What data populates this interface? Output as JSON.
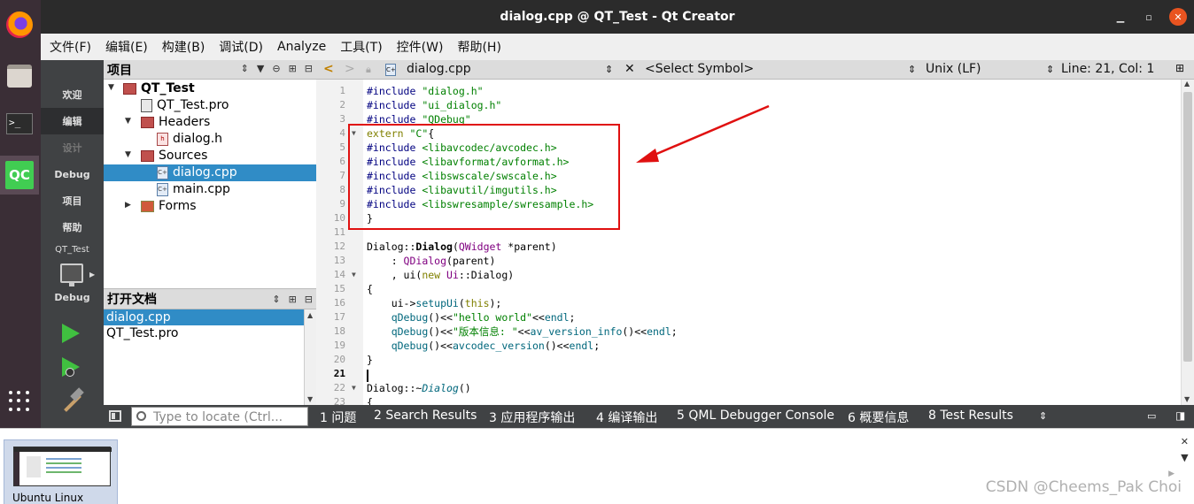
{
  "window": {
    "title": "dialog.cpp @ QT_Test - Qt Creator",
    "minimize": "▁",
    "maximize": "▫",
    "close": "✕"
  },
  "dock": {
    "terminal_glyph": ">_",
    "qt_label": "QC"
  },
  "menu": [
    "文件(F)",
    "编辑(E)",
    "构建(B)",
    "调试(D)",
    "Analyze",
    "工具(T)",
    "控件(W)",
    "帮助(H)"
  ],
  "modes": {
    "welcome": "欢迎",
    "edit": "编辑",
    "design": "设计",
    "debug": "Debug",
    "projects": "项目",
    "help": "帮助"
  },
  "kit": {
    "project": "QT_Test",
    "build": "Debug"
  },
  "project_panel": {
    "title": "项目",
    "tree": {
      "root": "QT_Test",
      "pro": "QT_Test.pro",
      "headers": "Headers",
      "header_file": "dialog.h",
      "sources": "Sources",
      "source1": "dialog.cpp",
      "source2": "main.cpp",
      "forms": "Forms"
    }
  },
  "open_docs": {
    "title": "打开文档",
    "items": [
      "dialog.cpp",
      "QT_Test.pro"
    ]
  },
  "editor_toolbar": {
    "file": "dialog.cpp",
    "symbol": "<Select Symbol>",
    "line_ending": "Unix (LF)",
    "position": "Line: 21, Col: 1"
  },
  "code": {
    "current_line": 21,
    "lines": [
      "#include \"dialog.h\"",
      "#include \"ui_dialog.h\"",
      "#include \"QDebug\"",
      "extern \"C\"{",
      "#include <libavcodec/avcodec.h>",
      "#include <libavformat/avformat.h>",
      "#include <libswscale/swscale.h>",
      "#include <libavutil/imgutils.h>",
      "#include <libswresample/swresample.h>",
      "}",
      "",
      "Dialog::Dialog(QWidget *parent)",
      "    : QDialog(parent)",
      "    , ui(new Ui::Dialog)",
      "{",
      "    ui->setupUi(this);",
      "    qDebug()<<\"hello world\"<<endl;",
      "    qDebug()<<\"版本信息: \"<<av_version_info()<<endl;",
      "    qDebug()<<avcodec_version()<<endl;",
      "}",
      "",
      "Dialog::~Dialog()",
      "{"
    ]
  },
  "output_bar": {
    "locate_placeholder": "Type to locate (Ctrl...",
    "tabs": [
      "1 问题",
      "2 Search Results",
      "3 应用程序输出",
      "4 编译输出",
      "5 QML Debugger Console",
      "6 概要信息",
      "8 Test Results"
    ]
  },
  "taskbar": {
    "item": "Ubuntu Linux",
    "watermark": "CSDN @Cheems_Pak Choi"
  },
  "colors": {
    "annotation": "#e01010",
    "selection": "#308cc6",
    "qt_green": "#41cd52"
  }
}
